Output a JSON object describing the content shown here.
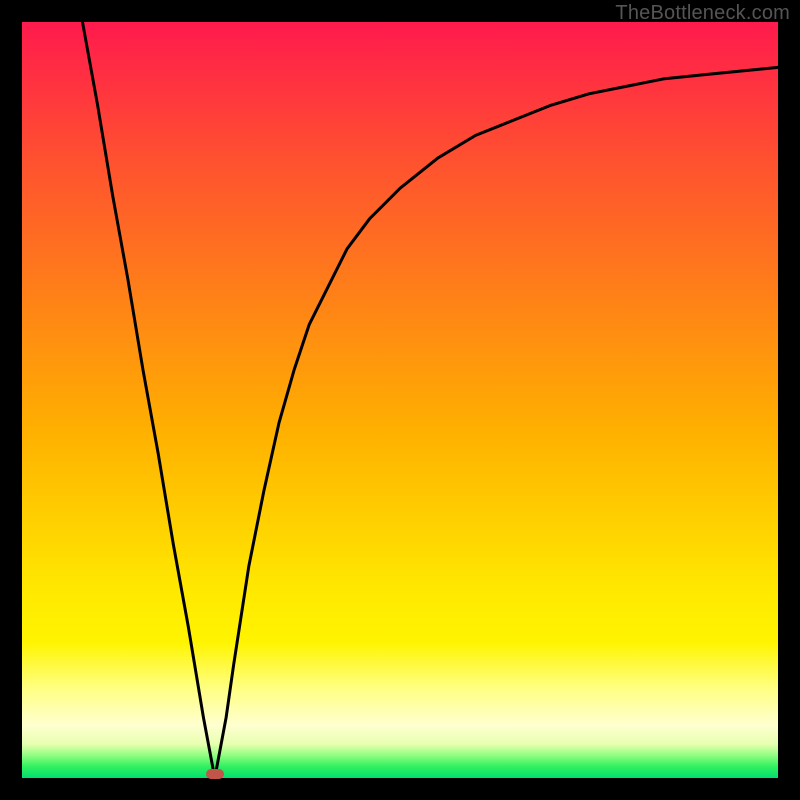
{
  "watermark": "TheBottleneck.com",
  "colors": {
    "frame_bg_top": "#ff1a4d",
    "frame_bg_bottom": "#00e070",
    "curve": "#000000",
    "marker": "#c1554a",
    "page_bg": "#000000"
  },
  "chart_data": {
    "type": "line",
    "title": "",
    "xlabel": "",
    "ylabel": "",
    "xlim": [
      0,
      100
    ],
    "ylim": [
      0,
      100
    ],
    "minimum_marker": {
      "x": 25.5,
      "y": 0
    },
    "series": [
      {
        "name": "curve",
        "x": [
          8,
          10,
          12,
          14,
          16,
          18,
          20,
          22,
          24,
          25.5,
          27,
          28,
          30,
          32,
          34,
          36,
          38,
          40,
          43,
          46,
          50,
          55,
          60,
          65,
          70,
          75,
          80,
          85,
          90,
          95,
          100
        ],
        "values": [
          100,
          89,
          77,
          66,
          54,
          43,
          31,
          20,
          8,
          0,
          8,
          15,
          28,
          38,
          47,
          54,
          60,
          64,
          70,
          74,
          78,
          82,
          85,
          87,
          89,
          90.5,
          91.5,
          92.5,
          93,
          93.5,
          94
        ]
      }
    ]
  }
}
